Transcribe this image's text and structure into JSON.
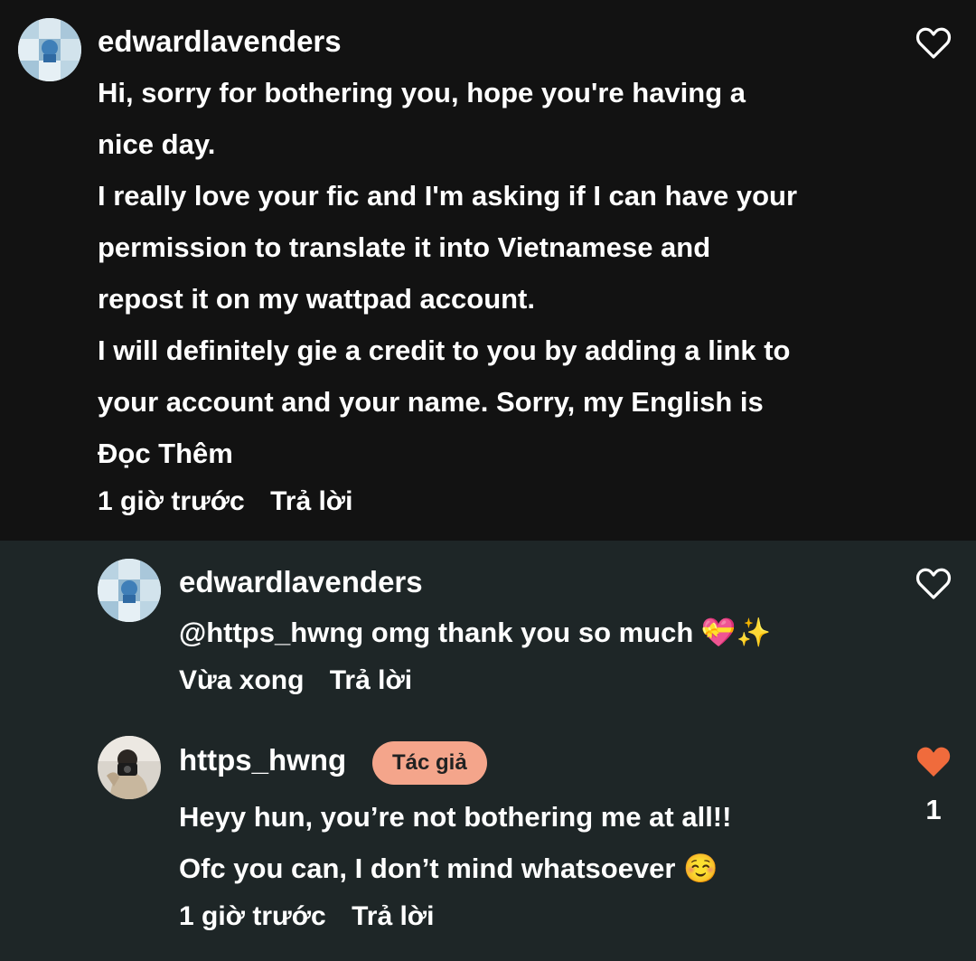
{
  "comment": {
    "username": "edwardlavenders",
    "lines": [
      "Hi, sorry for bothering you, hope you're having a",
      "nice day.",
      "I really love your fic and I'm asking if I can have your",
      "permission to translate it into Vietnamese and",
      "repost it on my wattpad account.",
      "I will definitely gie a credit to you by adding a link to",
      "your account and your name. Sorry, my English is"
    ],
    "read_more": "Đọc Thêm",
    "time": "1 giờ trước",
    "reply_label": "Trả lời",
    "liked": false,
    "avatar_icon": "avatar-blue-collage"
  },
  "replies": [
    {
      "username": "edwardlavenders",
      "text": "@https_hwng omg thank you so much",
      "emoji": [
        "💝",
        "✨"
      ],
      "time": "Vừa xong",
      "reply_label": "Trả lời",
      "liked": false,
      "avatar_icon": "avatar-blue-collage"
    },
    {
      "username": "https_hwng",
      "badge": "Tác giả",
      "lines": [
        "Heyy hun, you’re not bothering me at all!!",
        "Ofc you can, I don’t mind whatsoever"
      ],
      "emoji": "☺️",
      "time": "1 giờ trước",
      "reply_label": "Trả lời",
      "liked": true,
      "like_count": "1",
      "avatar_icon": "avatar-person-camera"
    }
  ],
  "colors": {
    "background": "#121212",
    "reply_background": "#1e2627",
    "text": "#ffffff",
    "badge": "#f4a58b",
    "liked_heart": "#f06b3c"
  }
}
